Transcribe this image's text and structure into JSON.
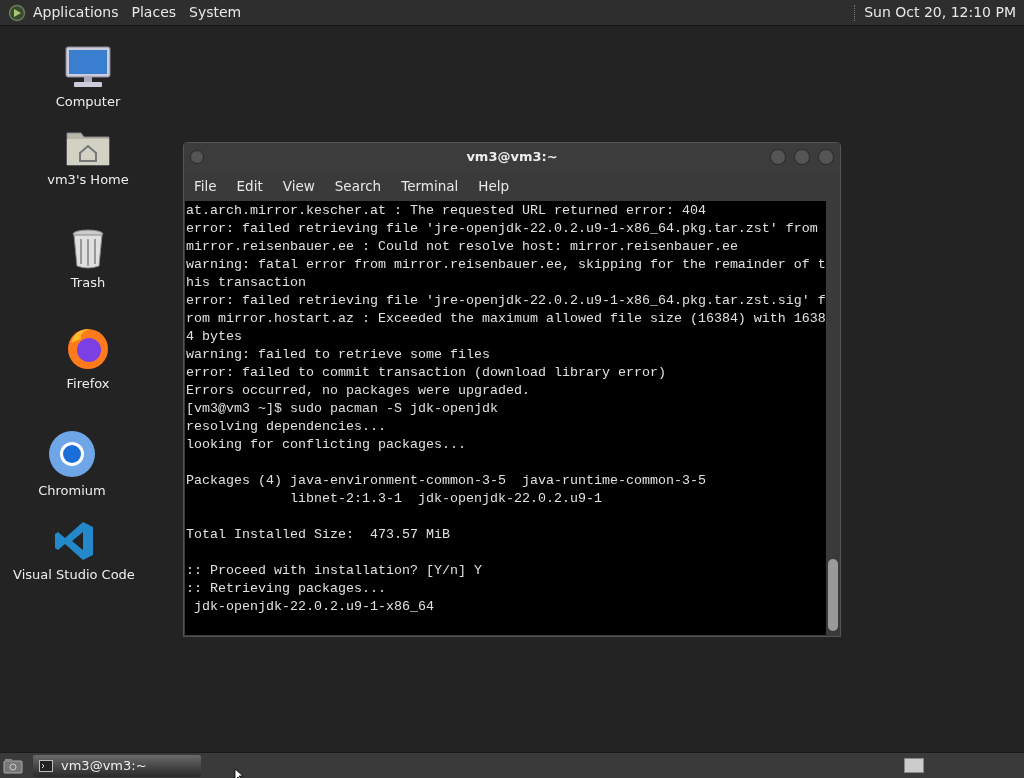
{
  "top_panel": {
    "menus": [
      "Applications",
      "Places",
      "System"
    ],
    "clock": "Sun Oct 20, 12:10 PM"
  },
  "desktop_icons": [
    {
      "kind": "computer",
      "label": "Computer"
    },
    {
      "kind": "home",
      "label": "vm3's Home"
    },
    {
      "kind": "trash",
      "label": "Trash"
    },
    {
      "kind": "firefox",
      "label": "Firefox"
    },
    {
      "kind": "chromium",
      "label": "Chromium"
    },
    {
      "kind": "vscode",
      "label": "Visual Studio Code"
    }
  ],
  "terminal": {
    "title": "vm3@vm3:~",
    "menu": [
      "File",
      "Edit",
      "View",
      "Search",
      "Terminal",
      "Help"
    ],
    "blocks": [
      [
        "at.arch.mirror.kescher.at : The requested URL returned error: 404",
        "error: failed retrieving file 'jre-openjdk-22.0.2.u9-1-x86_64.pkg.tar.zst' from",
        "mirror.reisenbauer.ee : Could not resolve host: mirror.reisenbauer.ee",
        "warning: fatal error from mirror.reisenbauer.ee, skipping for the remainder of t",
        "his transaction",
        "error: failed retrieving file 'jre-openjdk-22.0.2.u9-1-x86_64.pkg.tar.zst.sig' f",
        "rom mirror.hostart.az : Exceeded the maximum allowed file size (16384) with 1638",
        "4 bytes",
        "warning: failed to retrieve some files",
        "error: failed to commit transaction (download library error)",
        "Errors occurred, no packages were upgraded.",
        "[vm3@vm3 ~]$ sudo pacman -S jdk-openjdk",
        "resolving dependencies...",
        "looking for conflicting packages..."
      ],
      [
        "Packages (4) java-environment-common-3-5  java-runtime-common-3-5",
        "             libnet-2:1.3-1  jdk-openjdk-22.0.2.u9-1"
      ],
      [
        "Total Installed Size:  473.57 MiB"
      ],
      [
        ":: Proceed with installation? [Y/n] Y",
        ":: Retrieving packages...",
        " jdk-openjdk-22.0.2.u9-1-x86_64"
      ]
    ]
  },
  "taskbar": {
    "tasks": [
      {
        "label": "vm3@vm3:~",
        "selected": true
      }
    ]
  }
}
